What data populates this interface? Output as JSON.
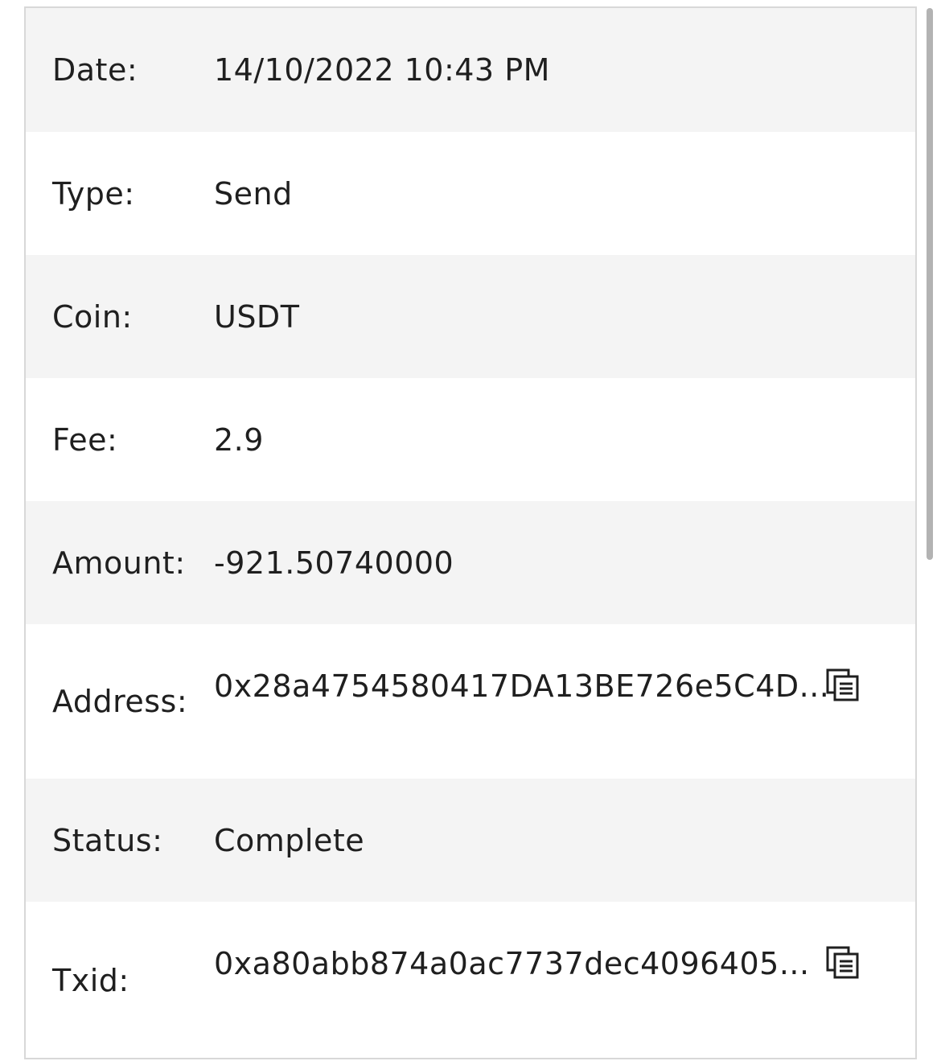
{
  "details": {
    "date": {
      "label": "Date:",
      "value": "14/10/2022 10:43 PM"
    },
    "type": {
      "label": "Type:",
      "value": "Send"
    },
    "coin": {
      "label": "Coin:",
      "value": "USDT"
    },
    "fee": {
      "label": "Fee:",
      "value": "2.9"
    },
    "amount": {
      "label": "Amount:",
      "value": "-921.50740000"
    },
    "address": {
      "label": "Address:",
      "value": "0x28a4754580417DA13BE726e5C4D...",
      "icon": "copy-icon"
    },
    "status": {
      "label": "Status:",
      "value": "Complete"
    },
    "txid": {
      "label": "Txid:",
      "value": "0xa80abb874a0ac7737dec4096405...",
      "icon": "copy-icon"
    }
  },
  "colors": {
    "shaded_row": "#f4f4f4",
    "border": "#d8d8d8",
    "text": "#1f1f1f",
    "scrollbar": "#b3b3b3"
  }
}
